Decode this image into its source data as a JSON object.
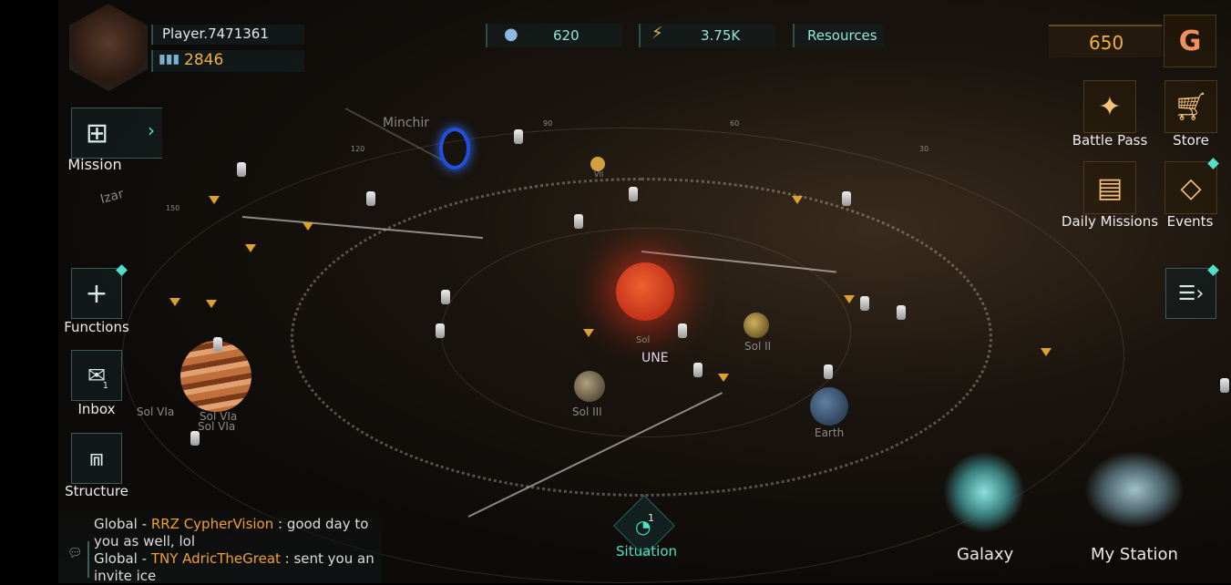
{
  "player": {
    "name": "Player.7471361",
    "power": "2846"
  },
  "top_bar": {
    "population": "620",
    "energy": "3.75K",
    "resources_label": "Resources"
  },
  "currency": {
    "gems": "650"
  },
  "left_menu": [
    {
      "label": "Mission"
    },
    {
      "label": "Functions"
    },
    {
      "label": "Inbox",
      "badge": "1"
    },
    {
      "label": "Structure"
    }
  ],
  "right_menu": [
    {
      "label": "Battle Pass"
    },
    {
      "label": "Store"
    },
    {
      "label": "Daily Missions"
    },
    {
      "label": "Events"
    }
  ],
  "map": {
    "labels": {
      "minchir": "Minchir",
      "izar": "Izar",
      "sol": "Sol",
      "sol_ii": "Sol II",
      "sol_iii": "Sol III",
      "sol_via_1": "Sol VIa",
      "sol_via_2": "Sol VIa",
      "sol_via_3": "Sol VIa",
      "earth": "Earth",
      "une": "UNE",
      "vii": "VII"
    },
    "degrees": [
      "120",
      "90",
      "60",
      "30",
      "150"
    ]
  },
  "chat": [
    {
      "channel": "Global - ",
      "user": "RRZ CypherVision",
      "text": " : good day to you as well, lol"
    },
    {
      "channel": "Global - ",
      "user": "TNY AdricTheGreat",
      "text": " : sent you an invite ice"
    }
  ],
  "bottom": {
    "situation": "Situation",
    "situation_badge": "1",
    "galaxy": "Galaxy",
    "my_station": "My Station"
  },
  "colors": {
    "accent_teal": "#4ee0c8",
    "gold": "#f0b040",
    "sun": "#e8402a"
  }
}
